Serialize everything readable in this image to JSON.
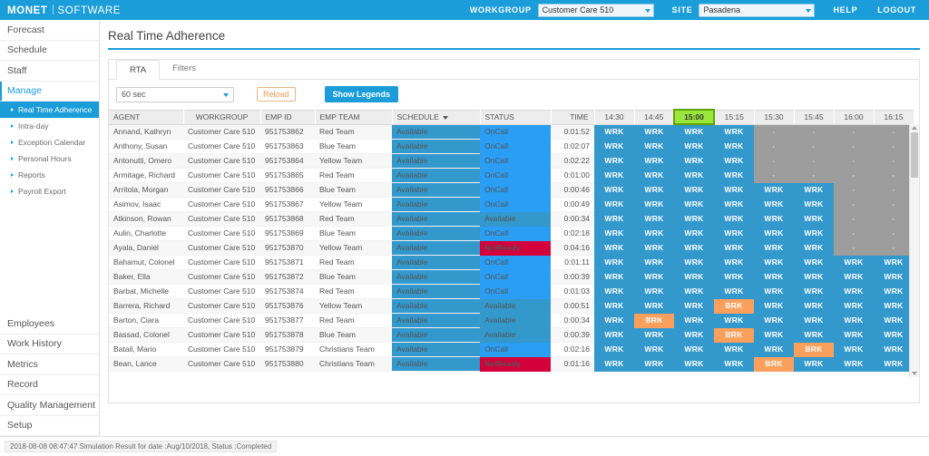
{
  "topbar": {
    "brand_primary": "MONET",
    "brand_secondary": "SOFTWARE",
    "workgroup_label": "WORKGROUP",
    "workgroup_value": "Customer Care 510",
    "site_label": "SITE",
    "site_value": "Pasadena",
    "help": "HELP",
    "logout": "LOGOUT",
    "accent": "#1b9dd9"
  },
  "sidebar": {
    "top_items": [
      {
        "label": "Forecast",
        "active": false
      },
      {
        "label": "Schedule",
        "active": false
      },
      {
        "label": "Staff",
        "active": false
      },
      {
        "label": "Manage",
        "active": true
      }
    ],
    "sub_items": [
      {
        "label": "Real Time Adherence",
        "selected": true
      },
      {
        "label": "Intra-day",
        "selected": false
      },
      {
        "label": "Exception Calendar",
        "selected": false
      },
      {
        "label": "Personal Hours",
        "selected": false
      },
      {
        "label": "Reports",
        "selected": false
      },
      {
        "label": "Payroll Export",
        "selected": false
      }
    ],
    "bottom_items": [
      {
        "label": "Employees"
      },
      {
        "label": "Work History"
      },
      {
        "label": "Metrics"
      },
      {
        "label": "Record"
      },
      {
        "label": "Quality Management"
      },
      {
        "label": "Setup"
      }
    ]
  },
  "page": {
    "title": "Real Time Adherence"
  },
  "tabs": [
    {
      "label": "RTA",
      "active": true
    },
    {
      "label": "Filters",
      "active": false
    }
  ],
  "toolbar": {
    "refresh_interval": "60 sec",
    "reload_label": "Reload",
    "legends_label": "Show Legends"
  },
  "grid": {
    "columns": [
      "AGENT",
      "WORKGROUP",
      "EMP ID",
      "EMP TEAM",
      "SCHEDULE",
      "STATUS",
      "TIME"
    ],
    "schedule_sorted": true,
    "time_columns": [
      "14:30",
      "14:45",
      "15:00",
      "15:15",
      "15:30",
      "15:45",
      "16:00",
      "16:15"
    ],
    "current_time_column": "15:00",
    "rows": [
      {
        "agent": "Annand, Kathryn",
        "workgroup": "Customer Care 510",
        "emp_id": "951753862",
        "emp_team": "Red Team",
        "schedule": "Available",
        "status": "OnCall",
        "time": "0:01:52",
        "alert": false,
        "cells": [
          "WRK",
          "WRK",
          "WRK",
          "WRK",
          "-",
          "-",
          "-",
          "-"
        ]
      },
      {
        "agent": "Anthony, Susan",
        "workgroup": "Customer Care 510",
        "emp_id": "951753863",
        "emp_team": "Blue Team",
        "schedule": "Available",
        "status": "OnCall",
        "time": "0:02:07",
        "alert": false,
        "cells": [
          "WRK",
          "WRK",
          "WRK",
          "WRK",
          "-",
          "-",
          "-",
          "-"
        ]
      },
      {
        "agent": "Antonutti, Omero",
        "workgroup": "Customer Care 510",
        "emp_id": "951753864",
        "emp_team": "Yellow Team",
        "schedule": "Available",
        "status": "OnCall",
        "time": "0:02:22",
        "alert": false,
        "cells": [
          "WRK",
          "WRK",
          "WRK",
          "WRK",
          "-",
          "-",
          "-",
          "-"
        ]
      },
      {
        "agent": "Armitage, Richard",
        "workgroup": "Customer Care 510",
        "emp_id": "951753865",
        "emp_team": "Red Team",
        "schedule": "Available",
        "status": "OnCall",
        "time": "0:01:00",
        "alert": false,
        "cells": [
          "WRK",
          "WRK",
          "WRK",
          "WRK",
          "-",
          "-",
          "-",
          "-"
        ]
      },
      {
        "agent": "Arritola, Morgan",
        "workgroup": "Customer Care 510",
        "emp_id": "951753866",
        "emp_team": "Blue Team",
        "schedule": "Available",
        "status": "OnCall",
        "time": "0:00:46",
        "alert": false,
        "cells": [
          "WRK",
          "WRK",
          "WRK",
          "WRK",
          "WRK",
          "WRK",
          "-",
          "-"
        ]
      },
      {
        "agent": "Asimov, Isaac",
        "workgroup": "Customer Care 510",
        "emp_id": "951753867",
        "emp_team": "Yellow Team",
        "schedule": "Available",
        "status": "OnCall",
        "time": "0:00:49",
        "alert": false,
        "cells": [
          "WRK",
          "WRK",
          "WRK",
          "WRK",
          "WRK",
          "WRK",
          "-",
          "-"
        ]
      },
      {
        "agent": "Atkinson, Rowan",
        "workgroup": "Customer Care 510",
        "emp_id": "951753868",
        "emp_team": "Red Team",
        "schedule": "Available",
        "status": "Available",
        "time": "0:00:34",
        "alert": false,
        "cells": [
          "WRK",
          "WRK",
          "WRK",
          "WRK",
          "WRK",
          "WRK",
          "-",
          "-"
        ]
      },
      {
        "agent": "Aulin, Charlotte",
        "workgroup": "Customer Care 510",
        "emp_id": "951753869",
        "emp_team": "Blue Team",
        "schedule": "Available",
        "status": "OnCall",
        "time": "0:02:18",
        "alert": false,
        "cells": [
          "WRK",
          "WRK",
          "WRK",
          "WRK",
          "WRK",
          "WRK",
          "-",
          "-"
        ]
      },
      {
        "agent": "Ayala, Daniel",
        "workgroup": "Customer Care 510",
        "emp_id": "951753870",
        "emp_team": "Yellow Team",
        "schedule": "Available",
        "status": "NotReady",
        "time": "0:04:16",
        "alert": true,
        "cells": [
          "WRK",
          "WRK",
          "WRK",
          "WRK",
          "WRK",
          "WRK",
          "-",
          "-"
        ]
      },
      {
        "agent": "Bahamut, Colonel",
        "workgroup": "Customer Care 510",
        "emp_id": "951753871",
        "emp_team": "Red Team",
        "schedule": "Available",
        "status": "OnCall",
        "time": "0:01:11",
        "alert": false,
        "cells": [
          "WRK",
          "WRK",
          "WRK",
          "WRK",
          "WRK",
          "WRK",
          "WRK",
          "WRK"
        ]
      },
      {
        "agent": "Baker, Ella",
        "workgroup": "Customer Care 510",
        "emp_id": "951753872",
        "emp_team": "Blue Team",
        "schedule": "Available",
        "status": "OnCall",
        "time": "0:00:39",
        "alert": false,
        "cells": [
          "WRK",
          "WRK",
          "WRK",
          "WRK",
          "WRK",
          "WRK",
          "WRK",
          "WRK"
        ]
      },
      {
        "agent": "Barbat, Michelle",
        "workgroup": "Customer Care 510",
        "emp_id": "951753874",
        "emp_team": "Red Team",
        "schedule": "Available",
        "status": "OnCall",
        "time": "0:01:03",
        "alert": false,
        "cells": [
          "WRK",
          "WRK",
          "WRK",
          "WRK",
          "WRK",
          "WRK",
          "WRK",
          "WRK"
        ]
      },
      {
        "agent": "Barrera, Richard",
        "workgroup": "Customer Care 510",
        "emp_id": "951753876",
        "emp_team": "Yellow Team",
        "schedule": "Available",
        "status": "Available",
        "time": "0:00:51",
        "alert": false,
        "cells": [
          "WRK",
          "WRK",
          "WRK",
          "BRK",
          "WRK",
          "WRK",
          "WRK",
          "WRK"
        ]
      },
      {
        "agent": "Barton, Ciara",
        "workgroup": "Customer Care 510",
        "emp_id": "951753877",
        "emp_team": "Red Team",
        "schedule": "Available",
        "status": "Available",
        "time": "0:00:34",
        "alert": false,
        "cells": [
          "WRK",
          "BRK",
          "WRK",
          "WRK",
          "WRK",
          "WRK",
          "WRK",
          "WRK"
        ]
      },
      {
        "agent": "Bassad, Colonel",
        "workgroup": "Customer Care 510",
        "emp_id": "951753878",
        "emp_team": "Blue Team",
        "schedule": "Available",
        "status": "Available",
        "time": "0:00:39",
        "alert": false,
        "cells": [
          "WRK",
          "WRK",
          "WRK",
          "BRK",
          "WRK",
          "WRK",
          "WRK",
          "WRK"
        ]
      },
      {
        "agent": "Batail, Mario",
        "workgroup": "Customer Care 510",
        "emp_id": "951753879",
        "emp_team": "Christians Team",
        "schedule": "Available",
        "status": "OnCall",
        "time": "0:02:16",
        "alert": false,
        "cells": [
          "WRK",
          "WRK",
          "WRK",
          "WRK",
          "WRK",
          "BRK",
          "WRK",
          "WRK"
        ]
      },
      {
        "agent": "Bean, Lance",
        "workgroup": "Customer Care 510",
        "emp_id": "951753880",
        "emp_team": "Christians Team",
        "schedule": "Available",
        "status": "NotReady",
        "time": "0:01:16",
        "alert": true,
        "cells": [
          "WRK",
          "WRK",
          "WRK",
          "WRK",
          "BRK",
          "WRK",
          "WRK",
          "WRK"
        ]
      }
    ]
  },
  "footer": {
    "message": "2018-08-08 08:47:47 Simulation Result for date :Aug/10/2018, Status :Completed"
  }
}
